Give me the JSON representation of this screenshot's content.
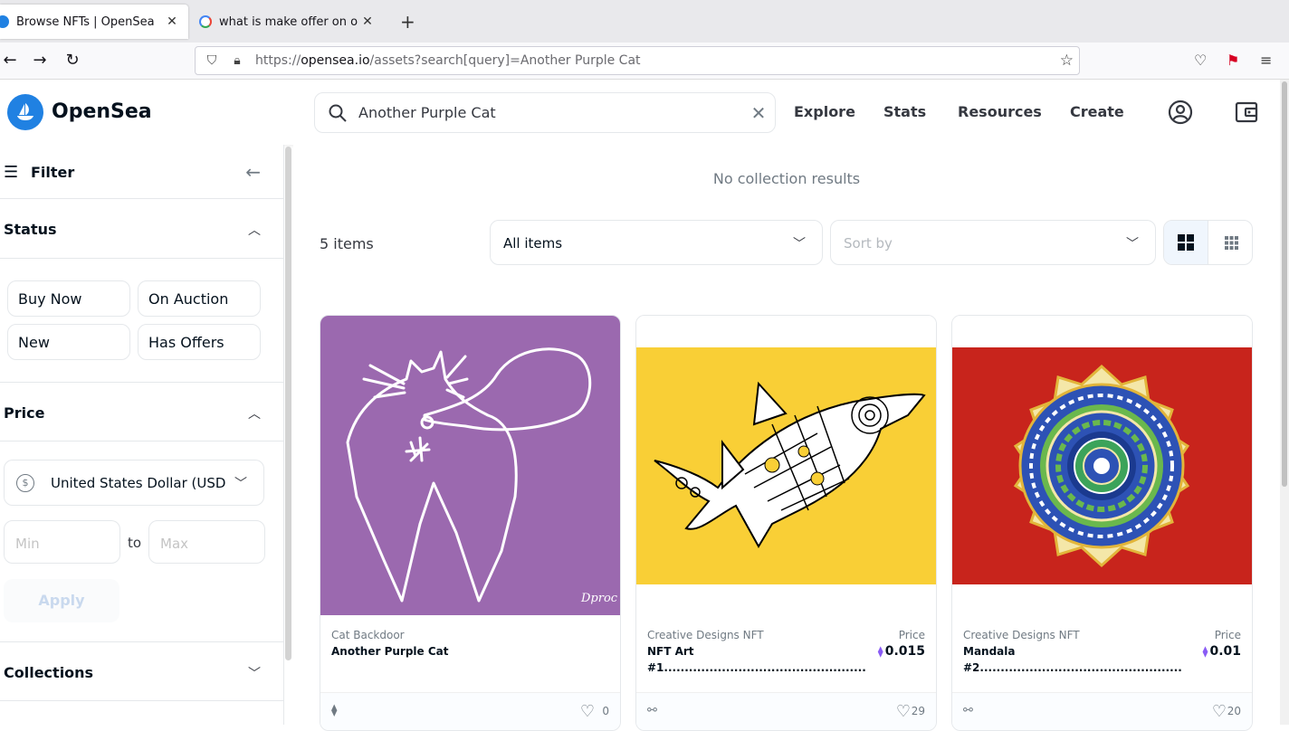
{
  "browser": {
    "tabs": [
      {
        "title": "Browse NFTs | OpenSea",
        "active": true
      },
      {
        "title": "what is make offer on open",
        "active": false
      }
    ],
    "url_prefix": "https://",
    "url_domain": "opensea.io",
    "url_path": "/assets?search[query]=Another Purple Cat"
  },
  "header": {
    "logo": "OpenSea",
    "search_value": "Another Purple Cat",
    "nav": [
      "Explore",
      "Stats",
      "Resources",
      "Create"
    ]
  },
  "sidebar": {
    "filter_label": "Filter",
    "status": {
      "title": "Status",
      "options": [
        "Buy Now",
        "On Auction",
        "New",
        "Has Offers"
      ]
    },
    "price": {
      "title": "Price",
      "currency": "United States Dollar (USD",
      "currency_symbol": "$",
      "min_placeholder": "Min",
      "max_placeholder": "Max",
      "to_label": "to",
      "apply_label": "Apply"
    },
    "collections_title": "Collections"
  },
  "main": {
    "no_collection_text": "No collection results",
    "item_count": "5 items",
    "items_filter": "All items",
    "sort_placeholder": "Sort by",
    "cards": [
      {
        "collection": "Cat Backdoor",
        "name": "Another Purple Cat",
        "name2": "",
        "price_label": "",
        "price": "",
        "likes": "0",
        "image_bg": "#9b69af",
        "signature": "Dproc"
      },
      {
        "collection": "Creative Designs NFT",
        "name": "NFT Art",
        "name2": "#1.................................................",
        "price_label": "Price",
        "price": "0.015",
        "likes": "29",
        "image_bg": "#f9cf36"
      },
      {
        "collection": "Creative Designs NFT",
        "name": "Mandala",
        "name2": "#2.................................................",
        "price_label": "Price",
        "price": "0.01",
        "likes": "20",
        "image_bg": "#c8241c"
      }
    ]
  },
  "colors": {
    "brand": "#2081e2",
    "eth": "#8a5cf5"
  }
}
